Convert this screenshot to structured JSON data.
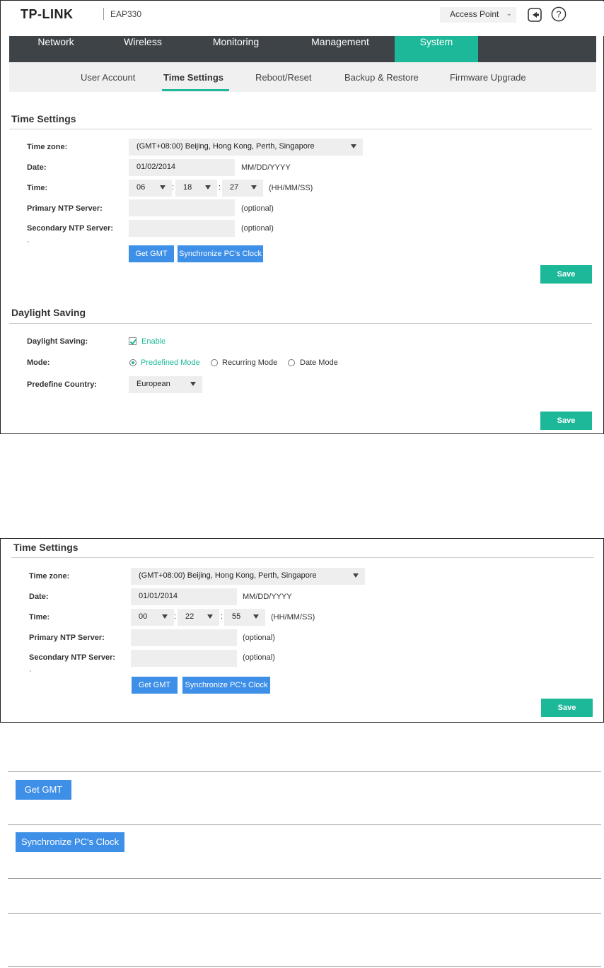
{
  "header": {
    "logo": "TP-LINK",
    "model": "EAP330",
    "mode_selector": "Access Point"
  },
  "nav": [
    "Network",
    "Wireless",
    "Monitoring",
    "Management",
    "System"
  ],
  "subnav": [
    "User Account",
    "Time Settings",
    "Reboot/Reset",
    "Backup & Restore",
    "Firmware Upgrade"
  ],
  "panel1": {
    "time_settings": {
      "title": "Time Settings",
      "timezone_label": "Time zone:",
      "timezone_value": "(GMT+08:00) Beijing, Hong Kong, Perth, Singapore",
      "date_label": "Date:",
      "date_value": "01/02/2014",
      "date_hint": "MM/DD/YYYY",
      "time_label": "Time:",
      "hh": "06",
      "mm": "18",
      "ss": "27",
      "time_hint": "(HH/MM/SS)",
      "primary_label": "Primary NTP Server:",
      "primary_hint": "(optional)",
      "secondary_label": "Secondary NTP Server:",
      "secondary_hint": "(optional)",
      "get_gmt": "Get GMT",
      "sync": "Synchronize PC's Clock",
      "save": "Save"
    },
    "daylight": {
      "title": "Daylight Saving",
      "ds_label": "Daylight Saving:",
      "enable": "Enable",
      "mode_label": "Mode:",
      "mode_predefined": "Predefined Mode",
      "mode_recurring": "Recurring Mode",
      "mode_date": "Date Mode",
      "country_label": "Predefine Country:",
      "country_value": "European",
      "save": "Save"
    }
  },
  "panel2": {
    "title": "Time Settings",
    "timezone_label": "Time zone:",
    "timezone_value": "(GMT+08:00) Beijing, Hong Kong, Perth, Singapore",
    "date_label": "Date:",
    "date_value": "01/01/2014",
    "date_hint": "MM/DD/YYYY",
    "time_label": "Time:",
    "hh": "00",
    "mm": "22",
    "ss": "55",
    "time_hint": "(HH/MM/SS)",
    "primary_label": "Primary NTP Server:",
    "primary_hint": "(optional)",
    "secondary_label": "Secondary NTP Server:",
    "secondary_hint": "(optional)",
    "get_gmt": "Get GMT",
    "sync": "Synchronize PC's Clock",
    "save": "Save"
  },
  "table": {
    "get_gmt": "Get GMT",
    "sync": "Synchronize PC's Clock"
  },
  "colors": {
    "accent": "#1cb899",
    "nav_bg": "#3e4347",
    "button_blue": "#3e8fe8"
  }
}
